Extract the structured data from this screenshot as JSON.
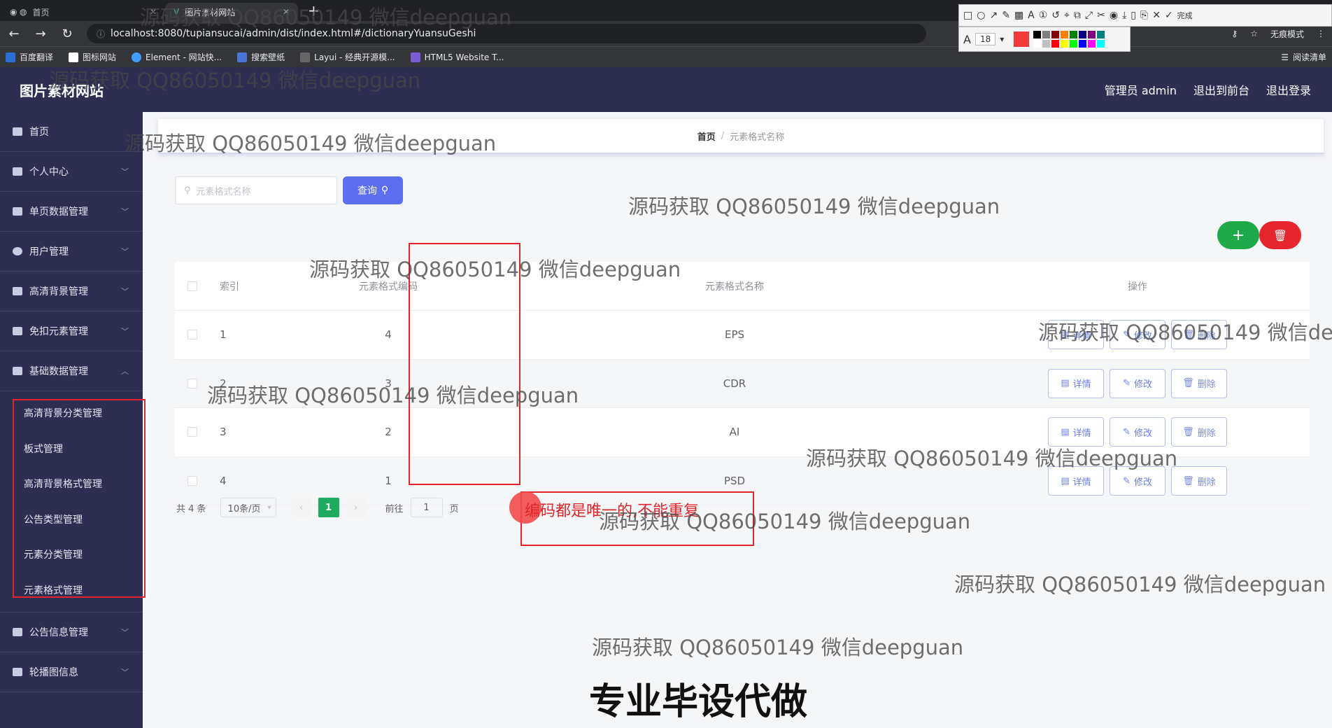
{
  "browser": {
    "tabs": [
      {
        "title": "首页",
        "active": false
      },
      {
        "title": "图片素材网站",
        "active": true
      }
    ],
    "url": "localhost:8080/tupiansucai/admin/dist/index.html#/dictionaryYuansuGeshi",
    "incognito_label": "无痕模式",
    "done_label": "完成",
    "font_size": "18",
    "bookmarks": [
      "百度翻译",
      "图标网站",
      "Element - 网站快...",
      "搜索壁纸",
      "Layui - 经典开源模...",
      "HTML5 Website T..."
    ],
    "reading_list": "阅读清单",
    "palette": [
      "#000000",
      "#808080",
      "#800000",
      "#ff8000",
      "#008000",
      "#000080",
      "#800080",
      "#008080",
      "#ffffff",
      "#c0c0c0",
      "#ff0000",
      "#ffff00",
      "#00ff00",
      "#0000ff",
      "#ff00ff",
      "#00ffff"
    ],
    "current_color": "#f23c3c"
  },
  "app": {
    "logo": "图片素材网站",
    "header": {
      "admin": "管理员 admin",
      "back_to_front": "退出到前台",
      "logout": "退出登录"
    },
    "sidebar": [
      {
        "label": "首页",
        "icon": "home-icon"
      },
      {
        "label": "个人中心",
        "icon": "user-icon"
      },
      {
        "label": "单页数据管理",
        "icon": "list-icon"
      },
      {
        "label": "用户管理",
        "icon": "clock-icon"
      },
      {
        "label": "高清背景管理",
        "icon": "image-icon"
      },
      {
        "label": "免扣元素管理",
        "icon": "image-icon"
      },
      {
        "label": "基础数据管理",
        "icon": "clipboard-icon"
      },
      {
        "label": "公告信息管理",
        "icon": "chat-icon"
      },
      {
        "label": "轮播图信息",
        "icon": "flag-icon"
      }
    ],
    "submenu": [
      "高清背景分类管理",
      "板式管理",
      "高清背景格式管理",
      "公告类型管理",
      "元素分类管理",
      "元素格式管理"
    ]
  },
  "breadcrumb": {
    "home": "首页",
    "current": "元素格式名称"
  },
  "search": {
    "placeholder": "元素格式名称",
    "button": "查询"
  },
  "table": {
    "headers": [
      "索引",
      "元素格式编码",
      "元素格式名称",
      "操作"
    ],
    "rows": [
      {
        "index": "1",
        "code": "4",
        "name": "EPS"
      },
      {
        "index": "2",
        "code": "3",
        "name": "CDR"
      },
      {
        "index": "3",
        "code": "2",
        "name": "AI"
      },
      {
        "index": "4",
        "code": "1",
        "name": "PSD"
      }
    ],
    "actions": {
      "detail": "详情",
      "edit": "修改",
      "delete": "删除"
    }
  },
  "pagination": {
    "total": "共 4 条",
    "page_size": "10条/页",
    "current_page": "1",
    "goto_prefix": "前往",
    "goto_value": "1",
    "goto_suffix": "页"
  },
  "annotation": "编码都是唯一的,不能重复",
  "watermark": "源码获取 QQ86050149 微信deepguan",
  "footer_title": "专业毕设代做"
}
